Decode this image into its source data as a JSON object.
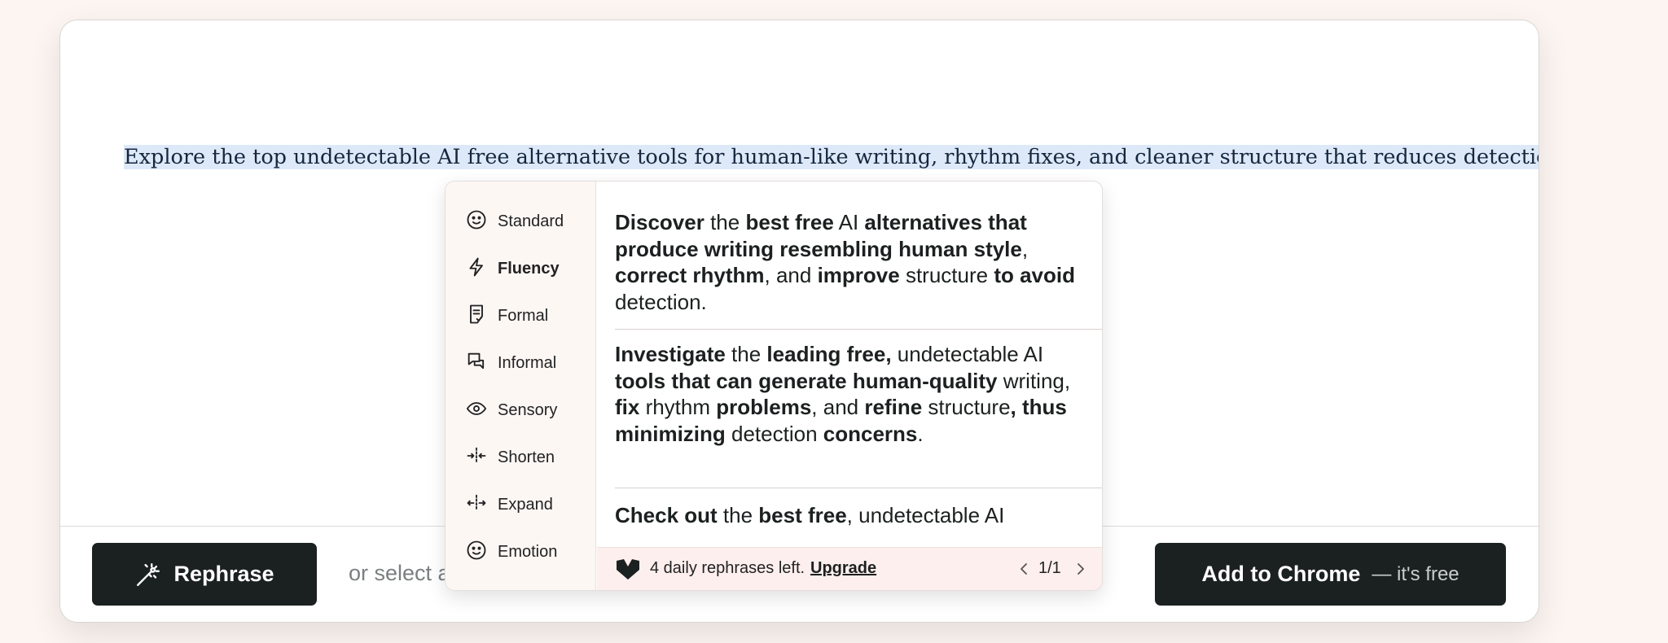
{
  "editor": {
    "source_text": "Explore the top undetectable AI free alternative tools for human-like writing, rhythm fixes, and cleaner structure that reduces detection issues."
  },
  "footer": {
    "rephrase_label": "Rephrase",
    "hint_text": "or select a",
    "chrome_label": "Add to Chrome",
    "chrome_sub": "— it's free"
  },
  "modes": [
    {
      "label": "Standard",
      "icon": "smiley-icon",
      "active": false
    },
    {
      "label": "Fluency",
      "icon": "lightning-icon",
      "active": true
    },
    {
      "label": "Formal",
      "icon": "document-check-icon",
      "active": false
    },
    {
      "label": "Informal",
      "icon": "chat-bubbles-icon",
      "active": false
    },
    {
      "label": "Sensory",
      "icon": "eye-icon",
      "active": false
    },
    {
      "label": "Shorten",
      "icon": "compress-arrows-icon",
      "active": false
    },
    {
      "label": "Expand",
      "icon": "expand-arrows-icon",
      "active": false
    },
    {
      "label": "Emotion",
      "icon": "smiley-icon",
      "active": false
    }
  ],
  "results": [
    {
      "segments": [
        {
          "t": "Discover",
          "b": true
        },
        {
          "t": " the ",
          "b": false
        },
        {
          "t": "best free",
          "b": true
        },
        {
          "t": " AI ",
          "b": false
        },
        {
          "t": "alternatives that produce writing resembling human style",
          "b": true
        },
        {
          "t": ", ",
          "b": false
        },
        {
          "t": "correct rhythm",
          "b": true
        },
        {
          "t": ", and ",
          "b": false
        },
        {
          "t": "improve",
          "b": true
        },
        {
          "t": " structure ",
          "b": false
        },
        {
          "t": "to avoid",
          "b": true
        },
        {
          "t": " detection.",
          "b": false
        }
      ]
    },
    {
      "segments": [
        {
          "t": "Investigate",
          "b": true
        },
        {
          "t": " the ",
          "b": false
        },
        {
          "t": "leading free,",
          "b": true
        },
        {
          "t": " undetectable AI ",
          "b": false
        },
        {
          "t": "tools that can generate human-quality",
          "b": true
        },
        {
          "t": " writing, ",
          "b": false
        },
        {
          "t": "fix",
          "b": true
        },
        {
          "t": " rhythm ",
          "b": false
        },
        {
          "t": "problems",
          "b": true
        },
        {
          "t": ", and ",
          "b": false
        },
        {
          "t": "refine",
          "b": true
        },
        {
          "t": " structure",
          "b": false
        },
        {
          "t": ", thus minimizing",
          "b": true
        },
        {
          "t": " detection ",
          "b": false
        },
        {
          "t": "concerns",
          "b": true
        },
        {
          "t": ".",
          "b": false
        }
      ]
    },
    {
      "segments": [
        {
          "t": "Check out",
          "b": true
        },
        {
          "t": " the ",
          "b": false
        },
        {
          "t": "best free",
          "b": true
        },
        {
          "t": ", undetectable AI",
          "b": false
        }
      ]
    }
  ],
  "status": {
    "logo_icon": "brand-logo-icon",
    "message": "4 daily rephrases left.",
    "upgrade_label": "Upgrade",
    "page_indicator": "1/1"
  },
  "colors": {
    "button_dark": "#1b2020",
    "selection_highlight": "#dde9f8",
    "status_bar": "#fdefed",
    "page_background": "#fdf5f2"
  }
}
